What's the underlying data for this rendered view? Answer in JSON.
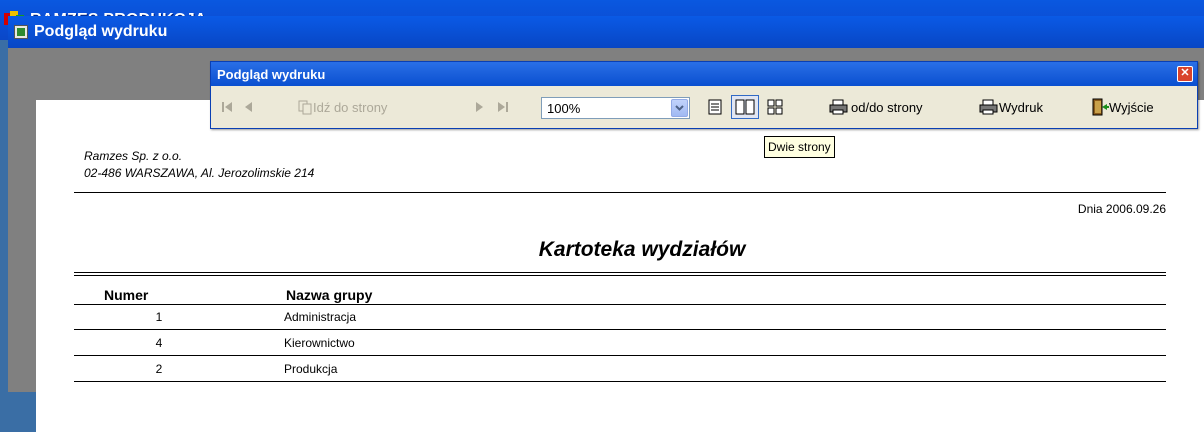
{
  "app": {
    "title": "RAMZES PRODUKCJA"
  },
  "child_window": {
    "title": "Podgląd wydruku"
  },
  "toolbar": {
    "title": "Podgląd wydruku",
    "goto_page_label": "Idź do strony",
    "zoom_value": "100%",
    "range_print_label": "od/do strony",
    "print_label": "Wydruk",
    "exit_label": "Wyjście",
    "close_glyph": "✕"
  },
  "tooltip": {
    "text": "Dwie strony"
  },
  "report": {
    "company_name": "Ramzes Sp. z o.o.",
    "company_address": "02-486 WARSZAWA, Al. Jerozolimskie 214",
    "date": "Dnia 2006.09.26",
    "title": "Kartoteka wydziałów",
    "columns": {
      "number": "Numer",
      "group_name": "Nazwa grupy"
    },
    "rows": [
      {
        "number": "1",
        "name": "Administracja"
      },
      {
        "number": "4",
        "name": "Kierownictwo"
      },
      {
        "number": "2",
        "name": "Produkcja"
      }
    ]
  },
  "colors": {
    "titlebar_blue": "#0a4fd6",
    "toolbar_bg": "#ece9d8",
    "tooltip_bg": "#ffffe1",
    "mdi_gray": "#808080"
  },
  "icons": [
    "app-logo-icon",
    "child-window-icon",
    "first-page-icon",
    "prev-page-icon",
    "goto-page-icon",
    "next-page-icon",
    "last-page-icon",
    "single-page-icon",
    "two-pages-icon",
    "multi-page-icon",
    "printer-icon",
    "exit-door-icon",
    "chevron-down-icon",
    "close-icon"
  ]
}
